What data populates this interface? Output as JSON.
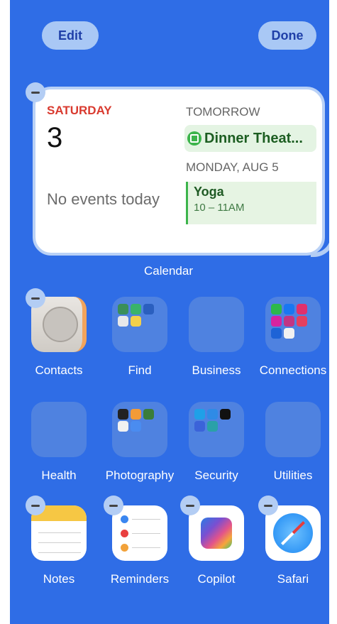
{
  "top_bar": {
    "edit_label": "Edit",
    "done_label": "Done"
  },
  "calendar_widget": {
    "today_day_name": "SATURDAY",
    "today_date": "3",
    "no_events_text": "No events today",
    "tomorrow_label": "TOMORROW",
    "tomorrow_event_title": "Dinner Theat...",
    "monday_label": "MONDAY, AUG 5",
    "monday_event_title": "Yoga",
    "monday_event_time": "10 – 11AM",
    "widget_label": "Calendar"
  },
  "apps": {
    "contacts": "Contacts",
    "find": "Find",
    "business": "Business",
    "connections": "Connections",
    "health": "Health",
    "photography": "Photography",
    "security": "Security",
    "utilities": "Utilities",
    "notes": "Notes",
    "reminders": "Reminders",
    "copilot": "Copilot",
    "safari": "Safari"
  },
  "colors": {
    "background": "#2f6de6",
    "accent_red": "#d93a2f",
    "event_green": "#3cb44b"
  }
}
